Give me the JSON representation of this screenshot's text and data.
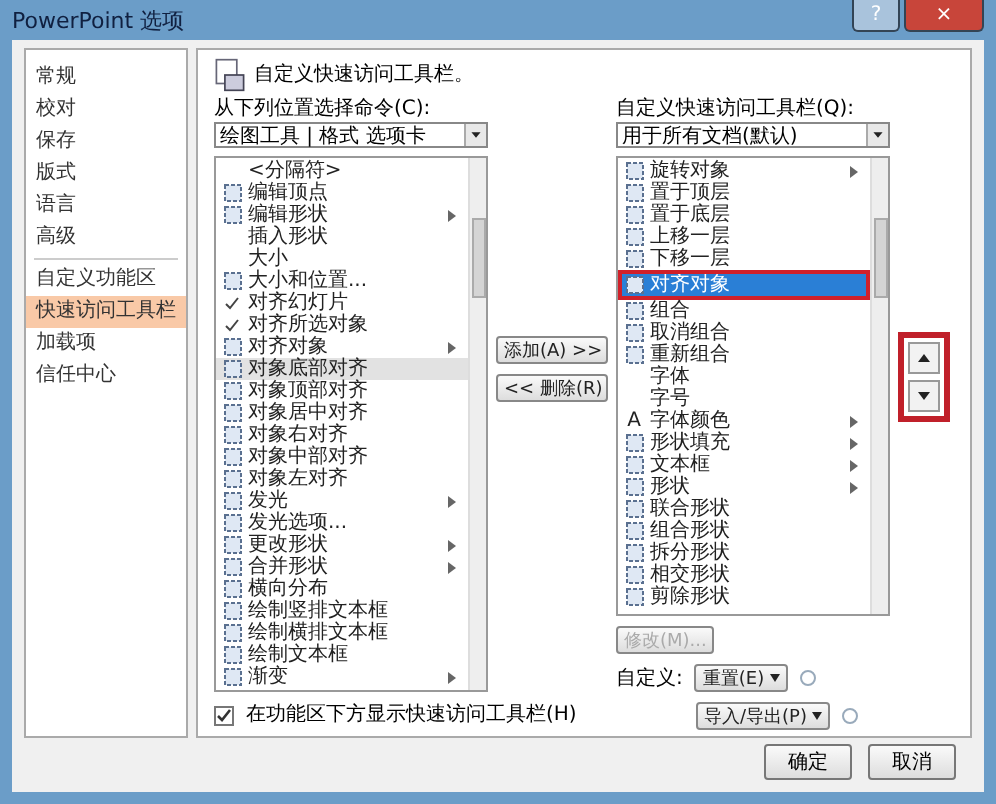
{
  "window": {
    "title": "PowerPoint 选项",
    "help": "?",
    "close": "×"
  },
  "sidebar": {
    "items": [
      {
        "label": "常规",
        "selected": false
      },
      {
        "label": "校对",
        "selected": false
      },
      {
        "label": "保存",
        "selected": false
      },
      {
        "label": "版式",
        "selected": false
      },
      {
        "label": "语言",
        "selected": false
      },
      {
        "label": "高级",
        "selected": false
      },
      {
        "label": "自定义功能区",
        "selected": false
      },
      {
        "label": "快速访问工具栏",
        "selected": true
      },
      {
        "label": "加载项",
        "selected": false
      },
      {
        "label": "信任中心",
        "selected": false
      }
    ]
  },
  "heading": "自定义快速访问工具栏。",
  "source": {
    "label": "从下列位置选择命令(C):",
    "value": "绘图工具 | 格式 选项卡",
    "items": [
      {
        "label": "<分隔符>",
        "kind": "none",
        "submenu": false,
        "selected": false
      },
      {
        "label": "编辑顶点",
        "kind": "icon",
        "submenu": false,
        "selected": false
      },
      {
        "label": "编辑形状",
        "kind": "icon",
        "submenu": true,
        "selected": false
      },
      {
        "label": "插入形状",
        "kind": "none",
        "submenu": false,
        "selected": false
      },
      {
        "label": "大小",
        "kind": "none",
        "submenu": false,
        "selected": false
      },
      {
        "label": "大小和位置...",
        "kind": "icon",
        "submenu": false,
        "selected": false
      },
      {
        "label": "对齐幻灯片",
        "kind": "check",
        "submenu": false,
        "selected": false
      },
      {
        "label": "对齐所选对象",
        "kind": "check",
        "submenu": false,
        "selected": false
      },
      {
        "label": "对齐对象",
        "kind": "icon",
        "submenu": true,
        "selected": false
      },
      {
        "label": "对象底部对齐",
        "kind": "icon",
        "submenu": false,
        "selected": true
      },
      {
        "label": "对象顶部对齐",
        "kind": "icon",
        "submenu": false,
        "selected": false
      },
      {
        "label": "对象居中对齐",
        "kind": "icon",
        "submenu": false,
        "selected": false
      },
      {
        "label": "对象右对齐",
        "kind": "icon",
        "submenu": false,
        "selected": false
      },
      {
        "label": "对象中部对齐",
        "kind": "icon",
        "submenu": false,
        "selected": false
      },
      {
        "label": "对象左对齐",
        "kind": "icon",
        "submenu": false,
        "selected": false
      },
      {
        "label": "发光",
        "kind": "icon",
        "submenu": true,
        "selected": false
      },
      {
        "label": "发光选项...",
        "kind": "icon",
        "submenu": false,
        "selected": false
      },
      {
        "label": "更改形状",
        "kind": "icon",
        "submenu": true,
        "selected": false
      },
      {
        "label": "合并形状",
        "kind": "icon",
        "submenu": true,
        "selected": false
      },
      {
        "label": "横向分布",
        "kind": "icon",
        "submenu": false,
        "selected": false
      },
      {
        "label": "绘制竖排文本框",
        "kind": "icon",
        "submenu": false,
        "selected": false
      },
      {
        "label": "绘制横排文本框",
        "kind": "icon",
        "submenu": false,
        "selected": false
      },
      {
        "label": "绘制文本框",
        "kind": "icon",
        "submenu": false,
        "selected": false
      },
      {
        "label": "渐变",
        "kind": "icon",
        "submenu": true,
        "selected": false
      }
    ]
  },
  "add_button": "添加(A) >>",
  "remove_button": "<< 删除(R)",
  "target": {
    "label": "自定义快速访问工具栏(Q):",
    "value": "用于所有文档(默认)",
    "items": [
      {
        "label": "旋转对象",
        "kind": "icon",
        "submenu": true,
        "selected": false,
        "outlined": false
      },
      {
        "label": "置于顶层",
        "kind": "icon",
        "submenu": false,
        "selected": false,
        "outlined": false
      },
      {
        "label": "置于底层",
        "kind": "icon",
        "submenu": false,
        "selected": false,
        "outlined": false
      },
      {
        "label": "上移一层",
        "kind": "icon",
        "submenu": false,
        "selected": false,
        "outlined": false
      },
      {
        "label": "下移一层",
        "kind": "icon",
        "submenu": false,
        "selected": false,
        "outlined": false
      },
      {
        "label": "对齐对象",
        "kind": "icon",
        "submenu": false,
        "selected": true,
        "outlined": true
      },
      {
        "label": "组合",
        "kind": "icon",
        "submenu": false,
        "selected": false,
        "outlined": false
      },
      {
        "label": "取消组合",
        "kind": "icon",
        "submenu": false,
        "selected": false,
        "outlined": false
      },
      {
        "label": "重新组合",
        "kind": "icon",
        "submenu": false,
        "selected": false,
        "outlined": false
      },
      {
        "label": "字体",
        "kind": "none",
        "submenu": false,
        "selected": false,
        "outlined": false
      },
      {
        "label": "字号",
        "kind": "none",
        "submenu": false,
        "selected": false,
        "outlined": false
      },
      {
        "label": "字体颜色",
        "kind": "letter",
        "glyph": "A",
        "submenu": true,
        "selected": false,
        "outlined": false
      },
      {
        "label": "形状填充",
        "kind": "icon",
        "submenu": true,
        "selected": false,
        "outlined": false
      },
      {
        "label": "文本框",
        "kind": "icon",
        "submenu": true,
        "selected": false,
        "outlined": false
      },
      {
        "label": "形状",
        "kind": "icon",
        "submenu": true,
        "selected": false,
        "outlined": false
      },
      {
        "label": "联合形状",
        "kind": "icon",
        "submenu": false,
        "selected": false,
        "outlined": false
      },
      {
        "label": "组合形状",
        "kind": "icon",
        "submenu": false,
        "selected": false,
        "outlined": false
      },
      {
        "label": "拆分形状",
        "kind": "icon",
        "submenu": false,
        "selected": false,
        "outlined": false
      },
      {
        "label": "相交形状",
        "kind": "icon",
        "submenu": false,
        "selected": false,
        "outlined": false
      },
      {
        "label": "剪除形状",
        "kind": "icon",
        "submenu": false,
        "selected": false,
        "outlined": false
      }
    ]
  },
  "move": {
    "outlined": true
  },
  "modify_button": {
    "label": "修改(M)...",
    "disabled": true
  },
  "customize_label": "自定义:",
  "reset_button": "重置(E)",
  "import_export_button": "导入/导出(P)",
  "show_below": {
    "label": "在功能区下方显示快速访问工具栏(H)",
    "checked": true
  },
  "ok_button": "确定",
  "cancel_button": "取消"
}
